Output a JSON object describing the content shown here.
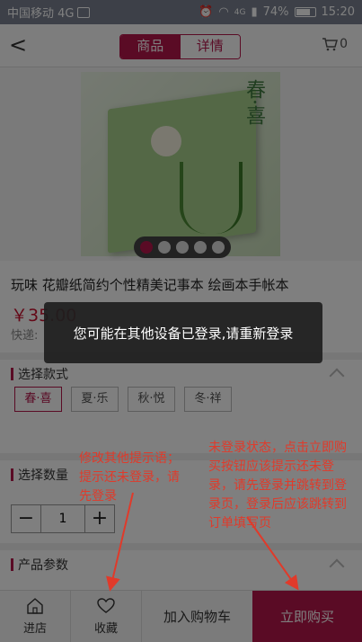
{
  "status_bar": {
    "carrier": "中国移动 4G",
    "network": "4G",
    "battery": "74%",
    "time": "15:20"
  },
  "header": {
    "back_label": "<",
    "tabs": [
      {
        "label": "商品",
        "active": true
      },
      {
        "label": "详情",
        "active": false
      }
    ],
    "cart_count": "0"
  },
  "gallery": {
    "cover_title": "春·喜",
    "dots": [
      {
        "active": true
      },
      {
        "active": false
      },
      {
        "active": false
      },
      {
        "active": false
      },
      {
        "active": false
      }
    ]
  },
  "product": {
    "title": "玩味 花瓣纸简约个性精美记事本 绘画本手帐本",
    "price": "￥35.00",
    "express_label": "快递:"
  },
  "style_section": {
    "label": "选择款式",
    "options": [
      {
        "label": "春·喜",
        "selected": true
      },
      {
        "label": "夏·乐",
        "selected": false
      },
      {
        "label": "秋·悦",
        "selected": false
      },
      {
        "label": "冬·祥",
        "selected": false
      }
    ]
  },
  "quantity_section": {
    "label": "选择数量",
    "minus": "−",
    "value": "1",
    "plus": "+"
  },
  "params_section": {
    "label": "产品参数"
  },
  "bottom_bar": {
    "store": "进店",
    "favorite": "收藏",
    "add_cart": "加入购物车",
    "buy_now": "立即购买"
  },
  "toast": {
    "message": "您可能在其他设备已登录,请重新登录"
  },
  "annotations": {
    "note1": "修改其他提示语；提示还未登录，请先登录",
    "note2": "未登录状态，点击立即购买按钮应该提示还未登录，请先登录并跳转到登录页，登录后应该跳转到订单填写页"
  },
  "colors": {
    "accent": "#b5164b",
    "price": "#c8102e",
    "annotation": "#e03a2a"
  }
}
